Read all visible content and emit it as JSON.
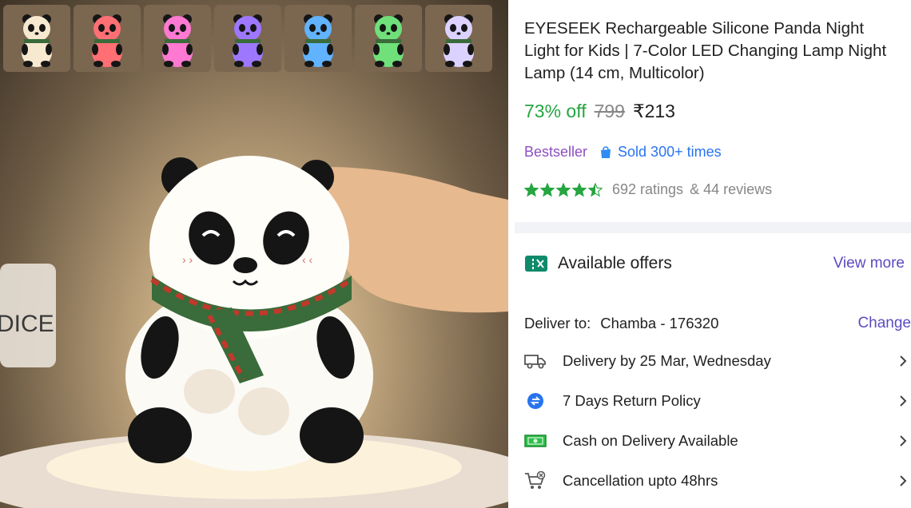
{
  "product": {
    "title": "EYESEEK Rechargeable Silicone Panda Night Light for Kids | 7-Color LED Changing Lamp Night Lamp (14 cm, Multicolor)",
    "discount": "73% off",
    "mrp": "799",
    "price": "₹213",
    "badge": "Bestseller",
    "sold": "Sold 300+ times",
    "ratings": "692 ratings",
    "reviews": "& 44 reviews",
    "star_rating": 4.5
  },
  "thumbnails": [
    {
      "name": "warm-white",
      "color": "#f6e9d0"
    },
    {
      "name": "red",
      "color": "#ff6f73"
    },
    {
      "name": "pink",
      "color": "#ff79d2"
    },
    {
      "name": "violet",
      "color": "#9d78ff"
    },
    {
      "name": "blue",
      "color": "#61b3ff"
    },
    {
      "name": "green",
      "color": "#6fe07a"
    },
    {
      "name": "lavender",
      "color": "#dcd2ff"
    }
  ],
  "offers": {
    "label": "Available offers",
    "view_more": "View more"
  },
  "delivery": {
    "label": "Deliver to:",
    "location": "Chamba - 176320",
    "change": "Change",
    "options": [
      {
        "icon": "truck-icon",
        "label": "Delivery by 25 Mar, Wednesday"
      },
      {
        "icon": "return-icon",
        "label": "7 Days Return Policy"
      },
      {
        "icon": "cash-icon",
        "label": "Cash on Delivery Available"
      },
      {
        "icon": "cart-cancel-icon",
        "label": "Cancellation upto 48hrs"
      }
    ]
  },
  "colors": {
    "green": "#26a541",
    "purple": "#8c4fbf",
    "blue": "#2874f0",
    "link": "#5b4bbf"
  }
}
